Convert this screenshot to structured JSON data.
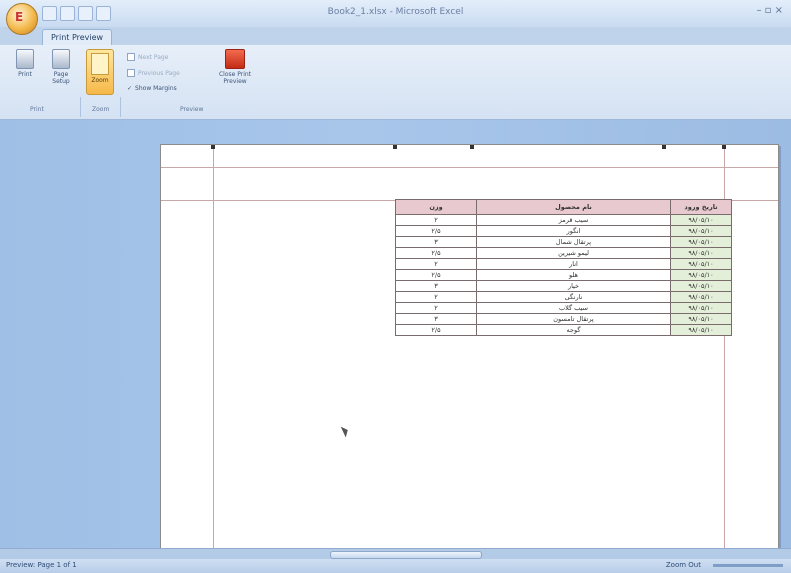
{
  "window": {
    "title": "Book2_1.xlsx - Microsoft Excel",
    "controls": "– ▫ ×"
  },
  "office_button": {
    "glyph": "E"
  },
  "ribbon": {
    "tab_label": "Print Preview",
    "print_label": "Print",
    "page_setup_label": "Page Setup",
    "zoom_label": "Zoom",
    "next_page_label": "Next Page",
    "previous_page_label": "Previous Page",
    "show_margins_label": "Show Margins",
    "close_label": "Close Print Preview",
    "groups": {
      "print": "Print",
      "zoom": "Zoom",
      "preview": "Preview"
    }
  },
  "sheet_table": {
    "headers": [
      "وزن",
      "نام محصول",
      "تاریخ ورود"
    ],
    "rows": [
      [
        "۲",
        "سیب قرمز",
        "۹۸/۰۵/۱۰"
      ],
      [
        "۲/۵",
        "انگور",
        "۹۸/۰۵/۱۰"
      ],
      [
        "۳",
        "پرتقال شمال",
        "۹۸/۰۵/۱۰"
      ],
      [
        "۲/۵",
        "لیمو شیرین",
        "۹۸/۰۵/۱۰"
      ],
      [
        "۲",
        "انار",
        "۹۸/۰۵/۱۰"
      ],
      [
        "۲/۵",
        "هلو",
        "۹۸/۰۵/۱۰"
      ],
      [
        "۳",
        "خیار",
        "۹۸/۰۵/۱۰"
      ],
      [
        "۲",
        "نارنگی",
        "۹۸/۰۵/۱۰"
      ],
      [
        "۲",
        "سیب گلاب",
        "۹۸/۰۵/۱۰"
      ],
      [
        "۳",
        "پرتقال تامسون",
        "۹۸/۰۵/۱۰"
      ],
      [
        "۲/۵",
        "گوجه",
        "۹۸/۰۵/۱۰"
      ]
    ]
  },
  "status": {
    "left_text": "Preview: Page 1 of 1",
    "zoom_text": "Zoom Out"
  },
  "colors": {
    "header_fill": "#e8c9cf",
    "date_fill": "#e4efd9",
    "workspace": "#a8c6ea"
  }
}
